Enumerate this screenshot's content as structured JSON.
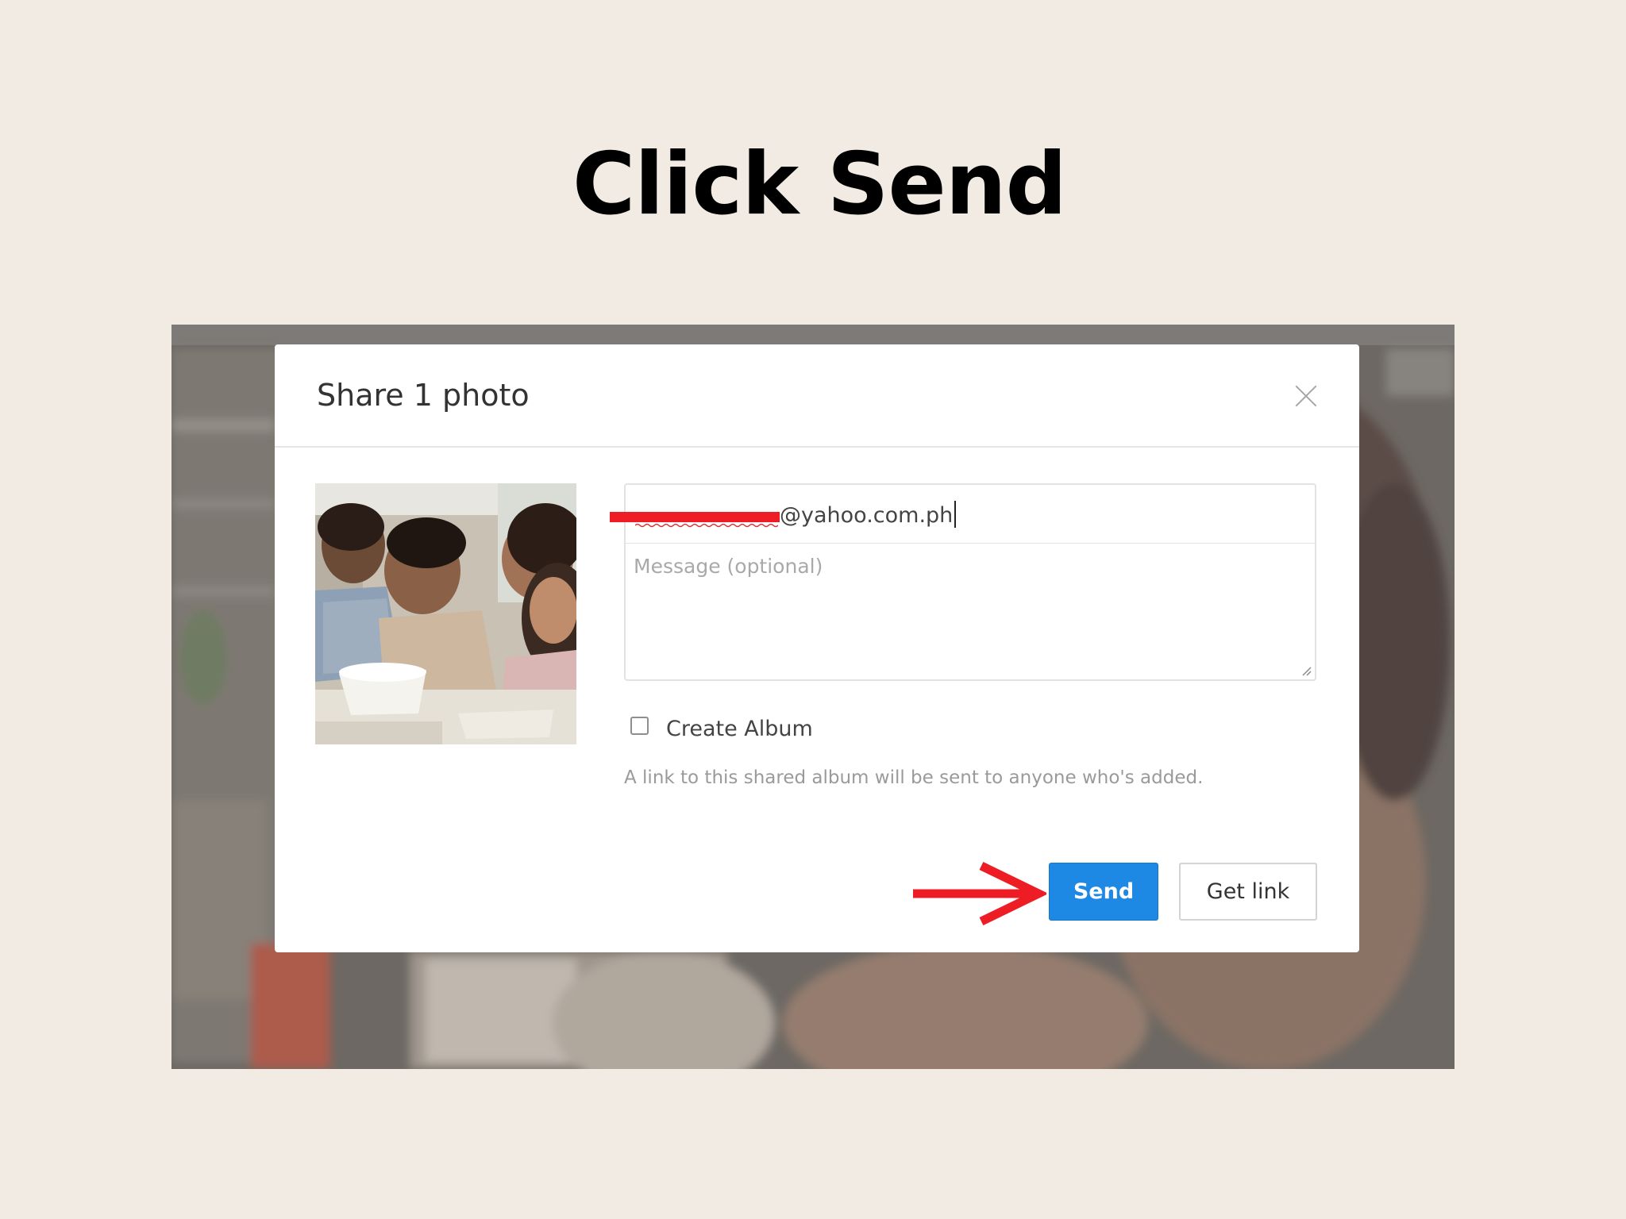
{
  "slide": {
    "title": "Click Send"
  },
  "dialog": {
    "title": "Share 1 photo",
    "close_icon": "close-icon",
    "recipient": {
      "value": "@yahoo.com.ph",
      "redacted": true
    },
    "message": {
      "placeholder": "Message (optional)",
      "value": ""
    },
    "create_album": {
      "label": "Create Album",
      "checked": false,
      "help_text": "A link to this shared album will be sent to anyone who's added."
    },
    "buttons": {
      "send_label": "Send",
      "get_link_label": "Get link"
    }
  },
  "annotation": {
    "arrow_icon": "arrow-right-icon",
    "arrow_color": "#ee1c24",
    "redaction_color": "#ee1c24"
  },
  "colors": {
    "slide_background": "#f1ebe4",
    "send_button": "#1e88e5"
  }
}
